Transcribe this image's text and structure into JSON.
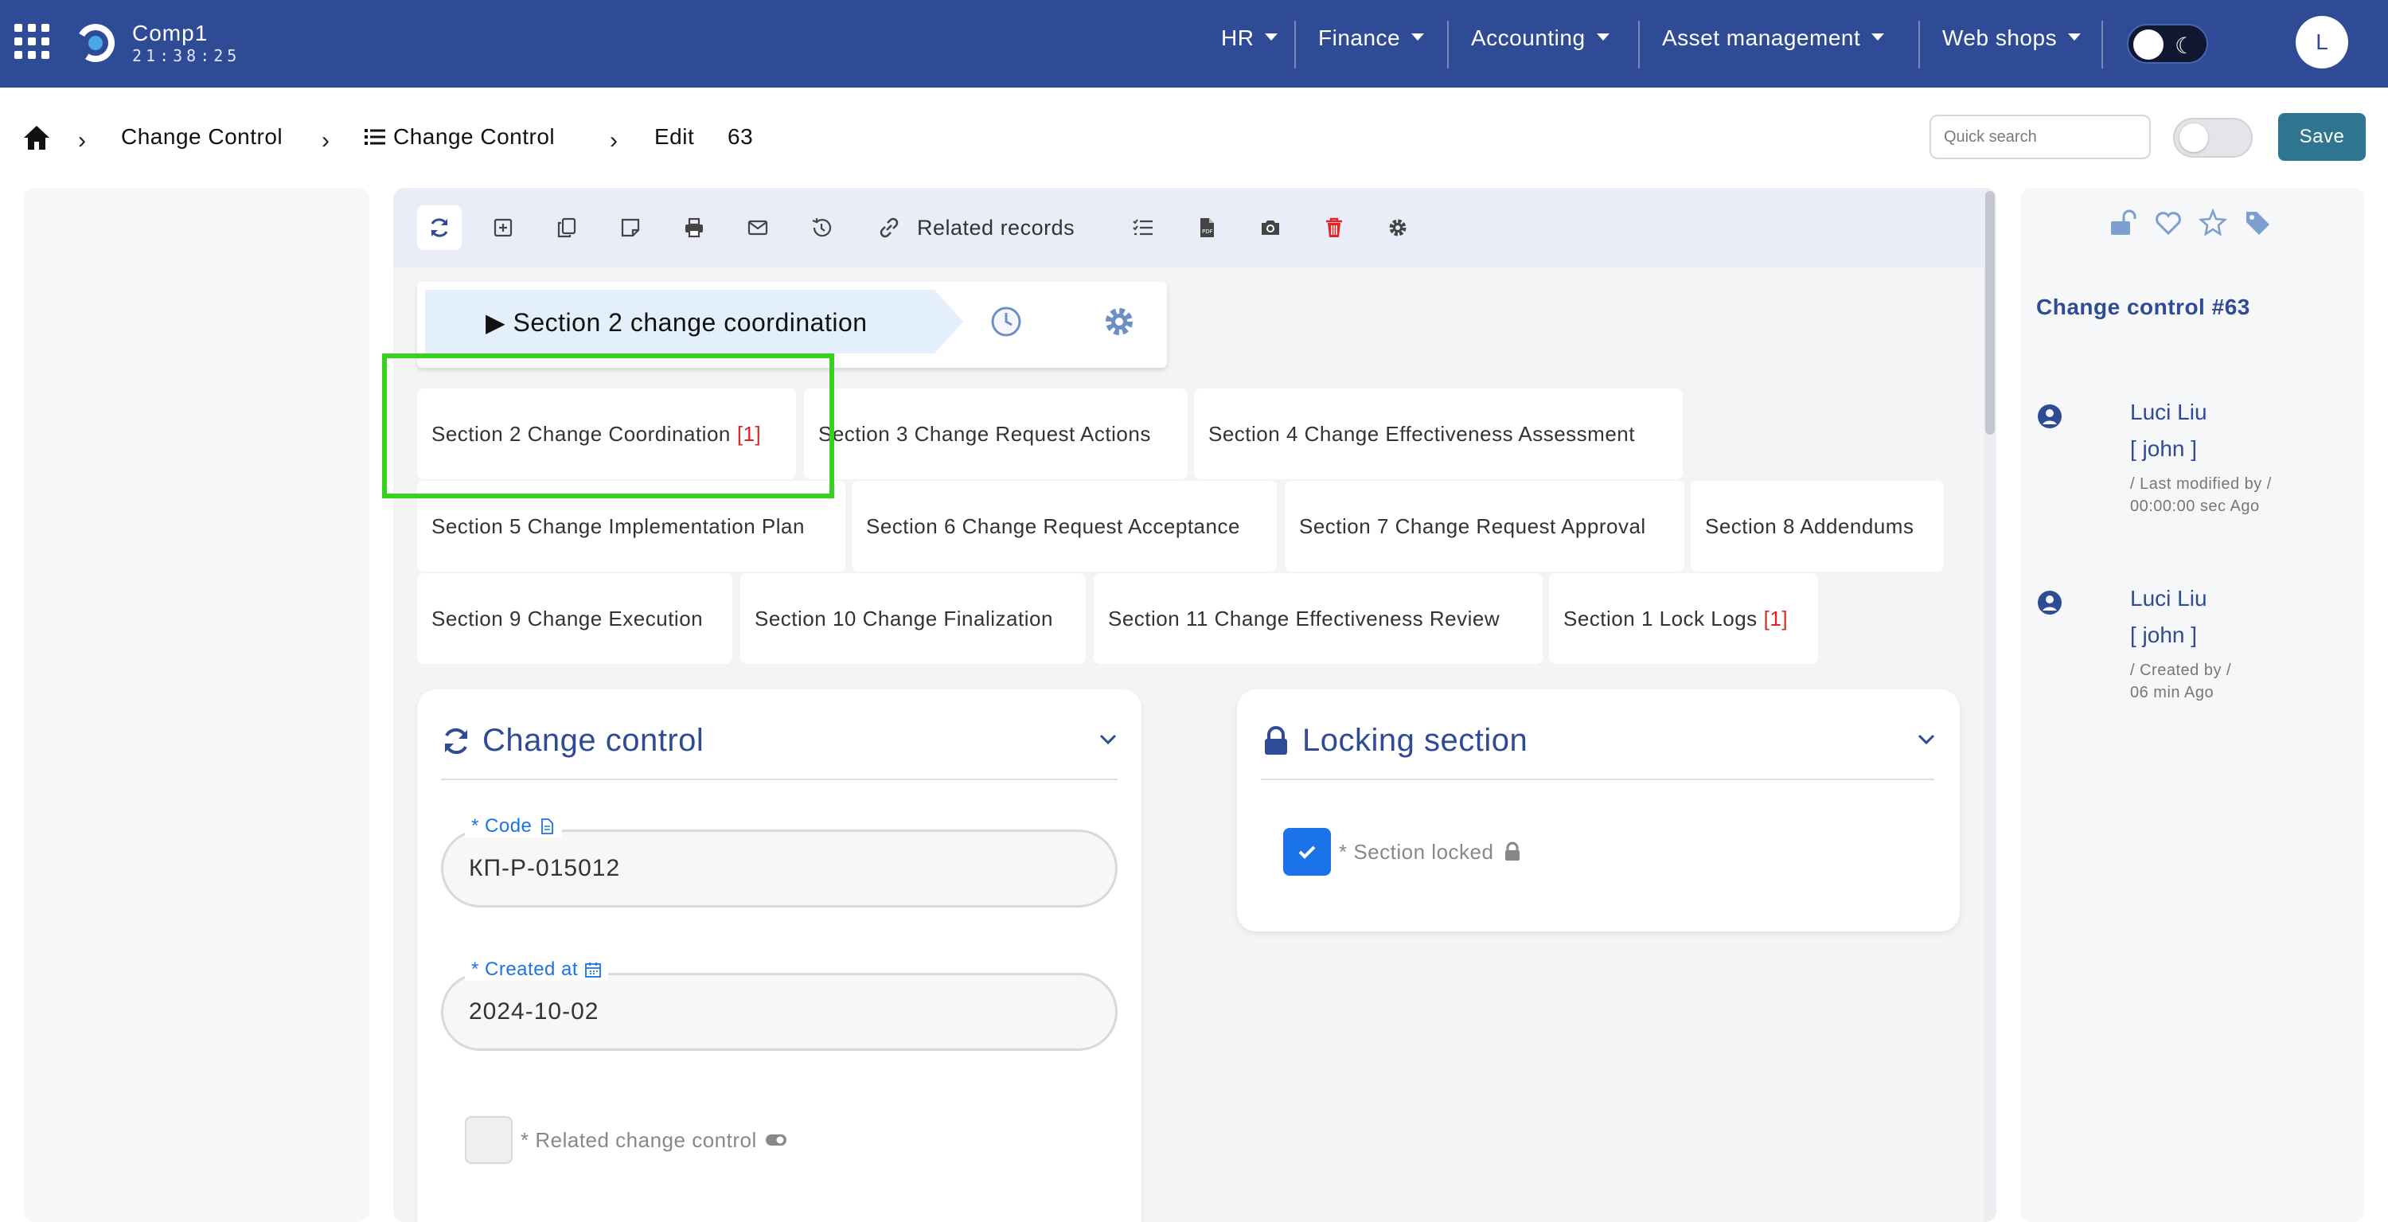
{
  "header": {
    "company": "Comp1",
    "clock": "21:38:25",
    "menus": [
      {
        "label": "HR"
      },
      {
        "label": "Finance"
      },
      {
        "label": "Accounting"
      },
      {
        "label": "Asset management"
      },
      {
        "label": "Web shops"
      }
    ],
    "avatar_initial": "L"
  },
  "breadcrumb": {
    "items": [
      "Change Control",
      "Change Control",
      "Edit"
    ],
    "record_id": "63"
  },
  "actions": {
    "search_placeholder": "Quick search",
    "save_label": "Save"
  },
  "toolbar": {
    "related_label": "Related records",
    "icons": [
      "refresh-icon",
      "add-icon",
      "copy-icon",
      "note-icon",
      "print-icon",
      "email-icon",
      "history-icon",
      "link-icon",
      "checklist-icon",
      "pdf-icon",
      "camera-icon",
      "trash-icon",
      "settings-icon"
    ],
    "delete_color": "#e02424"
  },
  "stage": {
    "label": "▶ Section 2 change coordination"
  },
  "sections": [
    {
      "label": "Section 2 Change Coordination",
      "count": "[1]"
    },
    {
      "label": "Section 3 Change Request Actions",
      "count": ""
    },
    {
      "label": "Section 4 Change Effectiveness Assessment",
      "count": ""
    },
    {
      "label": "Section 5 Change Implementation Plan",
      "count": ""
    },
    {
      "label": "Section 6 Change Request Acceptance",
      "count": ""
    },
    {
      "label": "Section 7 Change Request Approval",
      "count": ""
    },
    {
      "label": "Section 8 Addendums",
      "count": ""
    },
    {
      "label": "Section 9 Change Execution",
      "count": ""
    },
    {
      "label": "Section 10 Change Finalization",
      "count": ""
    },
    {
      "label": "Section 11 Change Effectiveness Review",
      "count": ""
    },
    {
      "label": "Section 1 Lock Logs",
      "count": "[1]"
    }
  ],
  "change_control_card": {
    "title": "Change control",
    "code_label": "* Code",
    "code_value": "КП-Р-015012",
    "created_label": "* Created at",
    "created_value": "2024-10-02",
    "related_label": "* Related change control"
  },
  "locking_card": {
    "title": "Locking section",
    "section_locked_label": "* Section locked",
    "section_locked": true
  },
  "record_panel": {
    "title": "Change control #63",
    "entries": [
      {
        "name": "Luci Liu",
        "login": "[ john ]",
        "meta1": "/ Last modified by /",
        "meta2": "00:00:00 sec Ago"
      },
      {
        "name": "Luci Liu",
        "login": "[ john ]",
        "meta1": "/ Created by /",
        "meta2": "06 min Ago"
      }
    ]
  },
  "colors": {
    "navbar": "#2f4b96",
    "accent": "#1a73e8",
    "save": "#2f7590",
    "highlight": "#39d11f",
    "count": "#e02424"
  }
}
